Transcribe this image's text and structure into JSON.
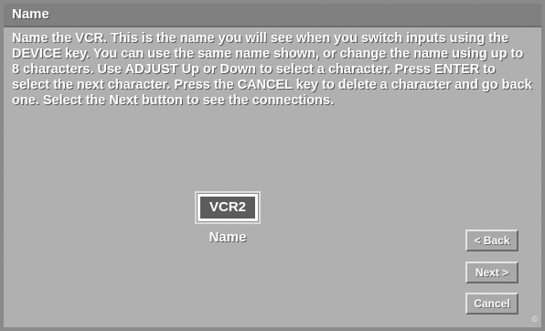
{
  "title": "Name",
  "instructions": "Name the VCR.  This is the name you will see when you switch inputs using the DEVICE key.  You can use the same name shown, or change the name using up to 8 characters.  Use ADJUST Up or Down to select a character.  Press ENTER to select the next character.  Press the CANCEL key to delete a character and go back one.  Select the Next button to see the connections.",
  "name_field": {
    "value": "VCR2",
    "label": "Name"
  },
  "buttons": {
    "back": "< Back",
    "next": "Next >",
    "cancel": "Cancel"
  },
  "colors": {
    "background": "#b0b0b0",
    "title_bar": "#7e7e7e",
    "field_fill": "#5c5c5c",
    "text": "#ffffff"
  }
}
